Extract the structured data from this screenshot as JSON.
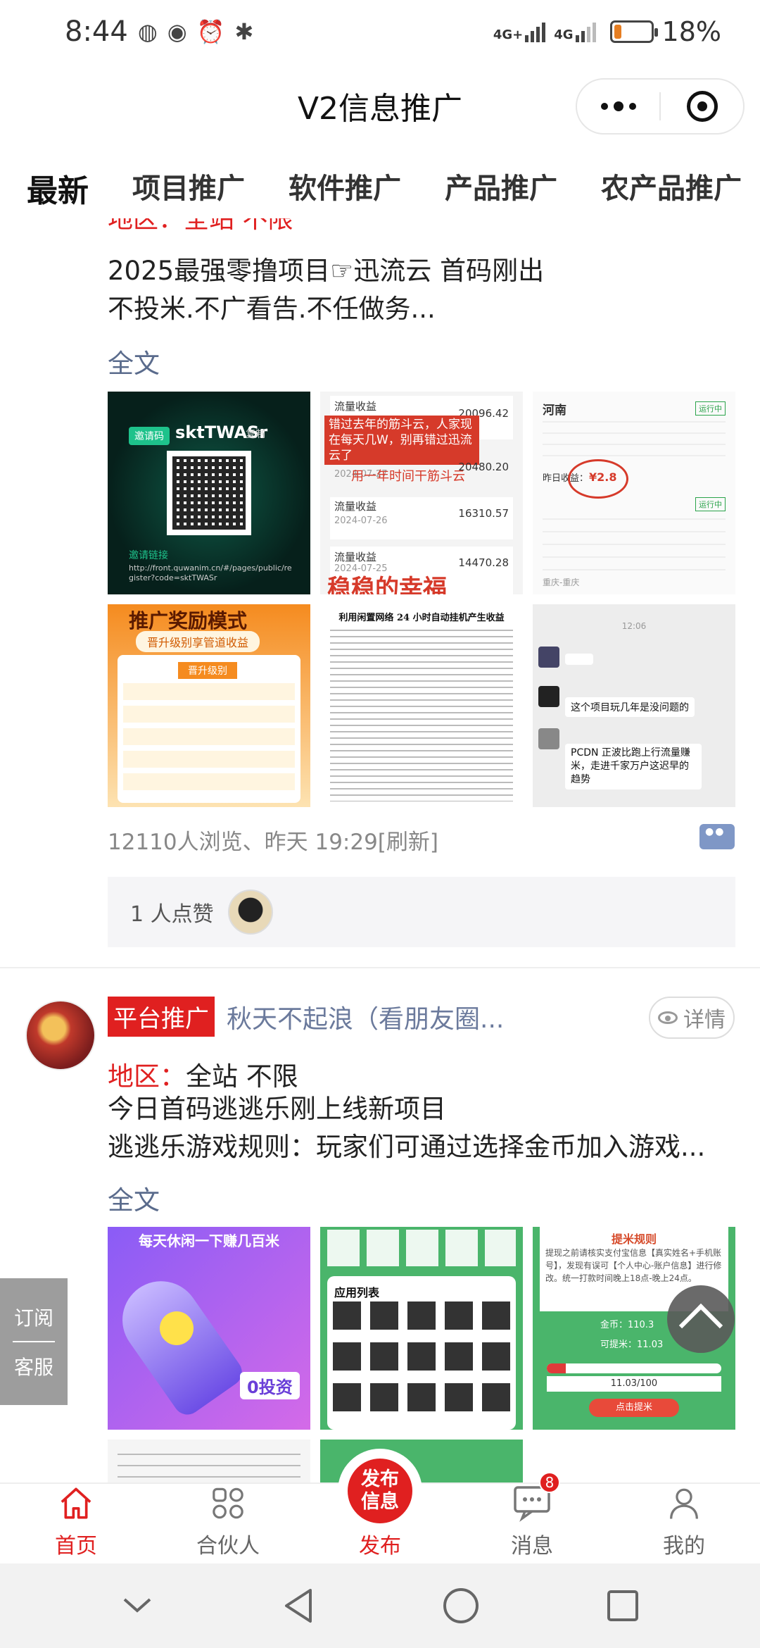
{
  "status_bar": {
    "time": "8:44",
    "net1": "4G+",
    "net2": "4G",
    "battery_text": "18%",
    "battery_level": 0.18
  },
  "header": {
    "title": "V2信息推广"
  },
  "tabs": [
    {
      "label": "最新",
      "active": true
    },
    {
      "label": "项目推广"
    },
    {
      "label": "软件推广"
    },
    {
      "label": "产品推广"
    },
    {
      "label": "农产品推广"
    }
  ],
  "post1": {
    "cut_region": "地区：全站 不限",
    "line1": "2025最强零撸项目☞迅流云 首码刚出",
    "line2": "不投米.不广看告.不任做务...",
    "fulltext": "全文",
    "images": {
      "img1": {
        "invite": "邀请码",
        "code": "sktTWASr",
        "copy": "复制",
        "link_label": "邀请链接",
        "link": "http://front.quwanim.cn/#/pages/public/register?code=sktTWASr"
      },
      "img2": {
        "rows": [
          {
            "label": "流量收益",
            "date": "2024-07-28",
            "value": "20096.42"
          },
          {
            "label": "流量收益",
            "date": "2024-07-27",
            "value": "20480.20"
          },
          {
            "label": "流量收益",
            "date": "2024-07-26",
            "value": "16310.57"
          },
          {
            "label": "流量收益",
            "date": "2024-07-25",
            "value": "14470.28"
          }
        ],
        "overlay1": "错过去年的筋斗云，人家现在每天几W，别再错过迅流云了",
        "overlay2": "用一年时间干筋斗云",
        "overlay3": "稳稳的幸福"
      },
      "img3": {
        "region": "河南",
        "status": "运行中",
        "earning": "¥2.8",
        "label": "昨日收益：",
        "region2": "重庆-重庆"
      },
      "img4": {
        "title": "推广奖励模式",
        "subtitle": "晋升级别享管道收益",
        "section": "晋升级别"
      },
      "img5": {
        "title": "利用闲置网络 24 小时自动挂机产生收益"
      },
      "img6": {
        "time": "12:06",
        "msg1": "这个项目玩几年是没问题的",
        "msg2": "PCDN 正波比跑上行流量赚米，走进千家万户这迟早的趋势"
      }
    },
    "meta": "12110人浏览、昨天 19:29[刷新]",
    "likes": "1 人点赞"
  },
  "post2": {
    "tag": "平台推广",
    "author": "秋天不起浪（看朋友圈...",
    "detail": "详情",
    "region_label": "地区：",
    "region_value": "全站 不限",
    "line1": "今日首码逃逃乐刚上线新项目",
    "line2": "逃逃乐游戏规则：玩家们可通过选择金币加入游戏...",
    "fulltext": "全文",
    "images": {
      "img1": {
        "badge": "0投资",
        "top_text": "每天休闲一下赚几百米"
      },
      "img2": {
        "section": "应用列表"
      },
      "img3": {
        "title": "提米规则",
        "text": "提现之前请核实支付宝信息【真实姓名+手机账号】，发现有误可【个人中心-账户信息】进行修改。统一打款时间晚上18点-晚上24点。",
        "coins_label": "金币：",
        "coins": "110.3",
        "withdraw_label": "可提米：",
        "withdraw": "11.03",
        "progress_text": "11.03/100",
        "btn": "点击提米"
      }
    }
  },
  "side": {
    "subscribe": "订阅",
    "service": "客服"
  },
  "bottom_nav": [
    {
      "label": "首页",
      "active": true
    },
    {
      "label": "合伙人"
    },
    {
      "label": "发布",
      "circle": "发布信息"
    },
    {
      "label": "消息",
      "badge": "8"
    },
    {
      "label": "我的"
    }
  ],
  "colors": {
    "accent": "#e02020",
    "link": "#5a6b8c"
  }
}
